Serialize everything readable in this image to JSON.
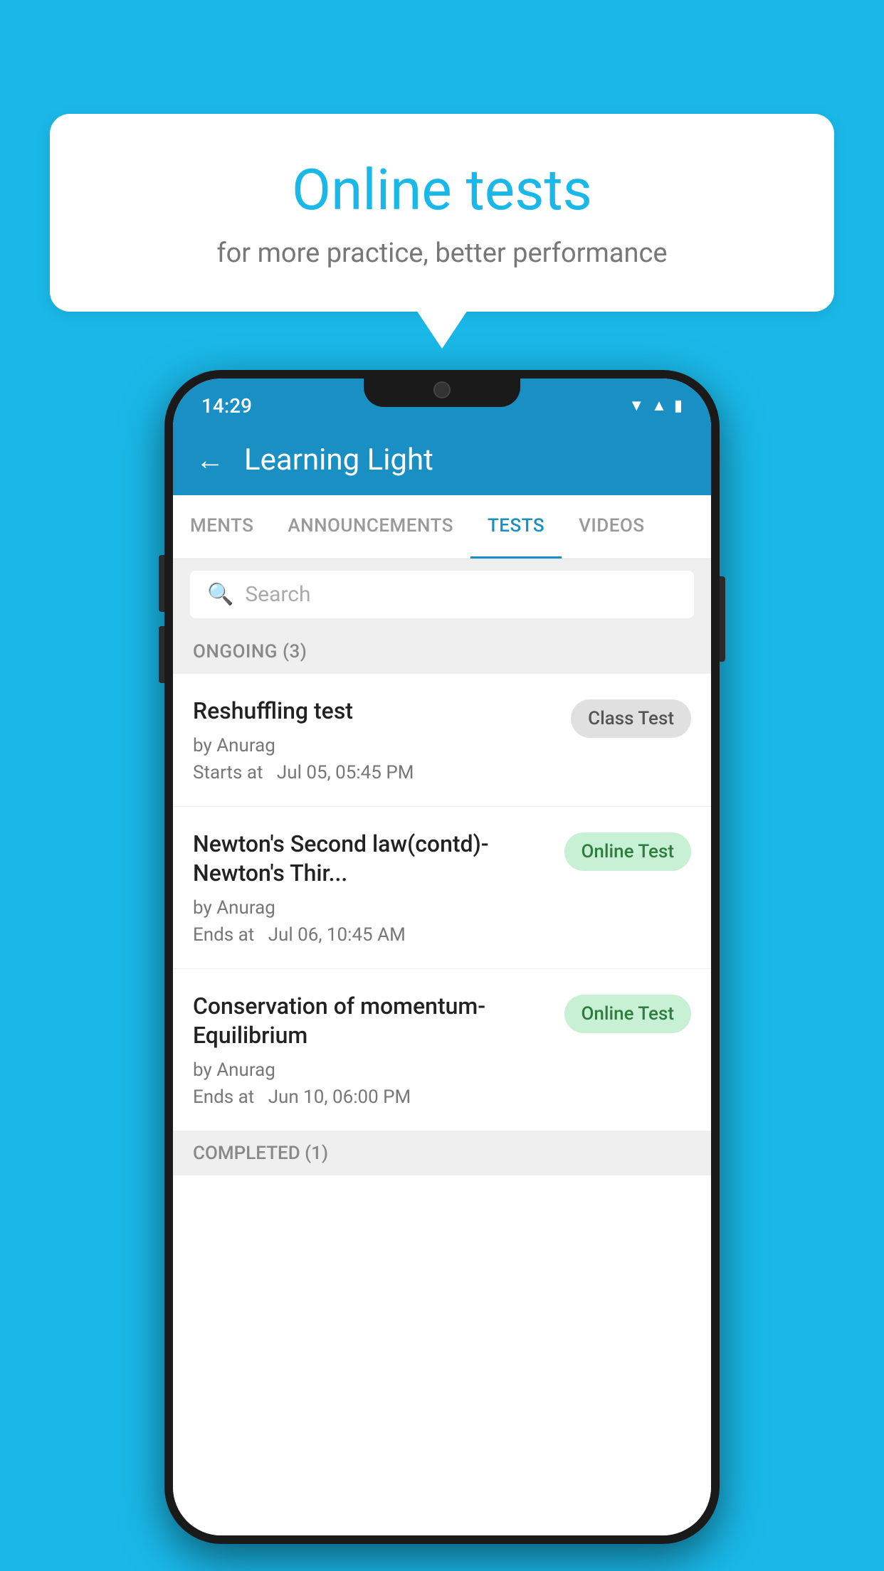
{
  "background": {
    "color": "#1ab8e8"
  },
  "speech_bubble": {
    "title": "Online tests",
    "subtitle": "for more practice, better performance"
  },
  "phone": {
    "status_bar": {
      "time": "14:29",
      "wifi_icon": "▲",
      "signal_icon": "◀",
      "battery_icon": "▮"
    },
    "app_bar": {
      "back_label": "←",
      "title": "Learning Light"
    },
    "tabs": [
      {
        "label": "MENTS",
        "active": false
      },
      {
        "label": "ANNOUNCEMENTS",
        "active": false
      },
      {
        "label": "TESTS",
        "active": true
      },
      {
        "label": "VIDEOS",
        "active": false
      }
    ],
    "search": {
      "placeholder": "Search"
    },
    "ongoing_section": {
      "header": "ONGOING (3)",
      "tests": [
        {
          "name": "Reshuffling test",
          "author": "by Anurag",
          "time_label": "Starts at",
          "time_value": "Jul 05, 05:45 PM",
          "badge": "Class Test",
          "badge_type": "class"
        },
        {
          "name": "Newton's Second law(contd)-Newton's Thir...",
          "author": "by Anurag",
          "time_label": "Ends at",
          "time_value": "Jul 06, 10:45 AM",
          "badge": "Online Test",
          "badge_type": "online"
        },
        {
          "name": "Conservation of momentum-Equilibrium",
          "author": "by Anurag",
          "time_label": "Ends at",
          "time_value": "Jun 10, 06:00 PM",
          "badge": "Online Test",
          "badge_type": "online"
        }
      ]
    },
    "completed_section": {
      "header": "COMPLETED (1)"
    }
  }
}
